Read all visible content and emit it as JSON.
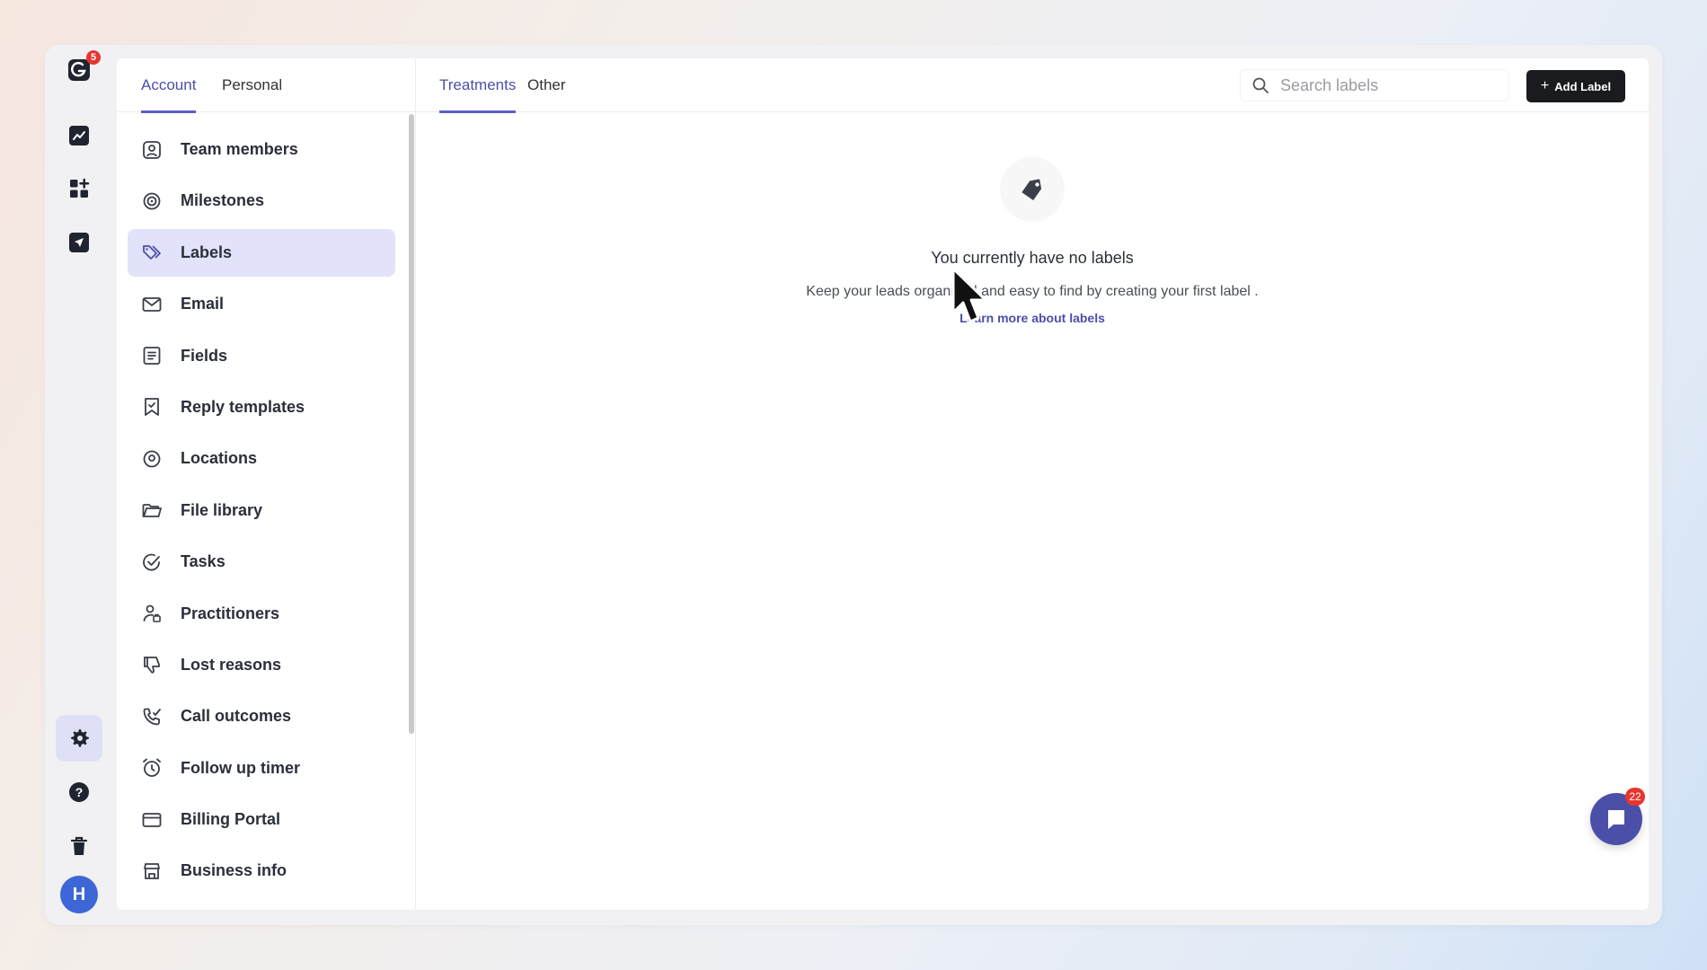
{
  "rail": {
    "logo_badge": "5",
    "items": [
      {
        "name": "analytics-icon"
      },
      {
        "name": "apps-icon"
      },
      {
        "name": "campaigns-icon"
      }
    ],
    "avatar_initial": "H"
  },
  "settings": {
    "tabs": [
      {
        "label": "Account",
        "active": true
      },
      {
        "label": "Personal",
        "active": false
      }
    ],
    "menu": [
      {
        "label": "Team members",
        "icon": "team-member-icon"
      },
      {
        "label": "Milestones",
        "icon": "milestone-icon"
      },
      {
        "label": "Labels",
        "icon": "label-icon",
        "active": true
      },
      {
        "label": "Email",
        "icon": "email-icon"
      },
      {
        "label": "Fields",
        "icon": "fields-icon"
      },
      {
        "label": "Reply templates",
        "icon": "bookmark-icon"
      },
      {
        "label": "Locations",
        "icon": "location-pin-icon"
      },
      {
        "label": "File library",
        "icon": "folder-icon"
      },
      {
        "label": "Tasks",
        "icon": "check-circle-icon"
      },
      {
        "label": "Practitioners",
        "icon": "practitioner-icon"
      },
      {
        "label": "Lost reasons",
        "icon": "thumbs-down-icon"
      },
      {
        "label": "Call outcomes",
        "icon": "phone-icon"
      },
      {
        "label": "Follow up timer",
        "icon": "alarm-clock-icon"
      },
      {
        "label": "Billing Portal",
        "icon": "credit-card-icon"
      },
      {
        "label": "Business info",
        "icon": "store-icon"
      }
    ]
  },
  "labels_page": {
    "tabs": [
      {
        "label": "Treatments",
        "active": true
      },
      {
        "label": "Other",
        "active": false
      }
    ],
    "search_placeholder": "Search labels",
    "add_button": "Add Label",
    "empty_title": "You currently have no labels",
    "empty_subtitle": "Keep your leads organised and easy to find by creating your first label .",
    "empty_link": "Learn more about labels"
  },
  "chat_badge": "22",
  "colors": {
    "accent": "#5b5fc7",
    "active_bg": "#e2e3fa",
    "badge": "#e8352f",
    "primary_button": "#1a1b1f"
  }
}
